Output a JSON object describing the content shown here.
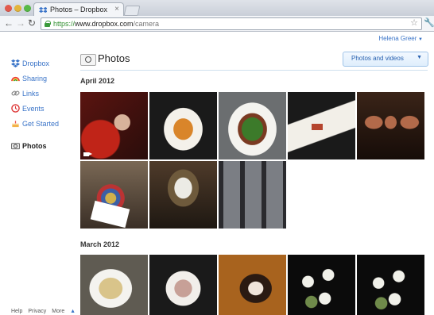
{
  "browser": {
    "tab_title": "Photos – Dropbox",
    "url_protocol": "https://",
    "url_host": "www.dropbox.com",
    "url_path": "/camera"
  },
  "header": {
    "user_name": "Helena Greer"
  },
  "sidebar": {
    "items": [
      {
        "label": "Dropbox",
        "icon": "dropbox-icon",
        "color": "#3a74c8"
      },
      {
        "label": "Sharing",
        "icon": "rainbow-icon",
        "color": "#3a74c8"
      },
      {
        "label": "Links",
        "icon": "link-icon",
        "color": "#3a74c8"
      },
      {
        "label": "Events",
        "icon": "events-icon",
        "color": "#3a74c8"
      },
      {
        "label": "Get Started",
        "icon": "cake-icon",
        "color": "#3a74c8"
      }
    ],
    "active": {
      "label": "Photos",
      "icon": "camera-icon"
    }
  },
  "main": {
    "title": "Photos",
    "filter_label": "Photos and videos",
    "sections": [
      {
        "label": "April 2012",
        "photo_count": 8
      },
      {
        "label": "March 2012",
        "photo_count": 5
      }
    ]
  },
  "footer": {
    "help": "Help",
    "privacy": "Privacy",
    "more": "More"
  }
}
